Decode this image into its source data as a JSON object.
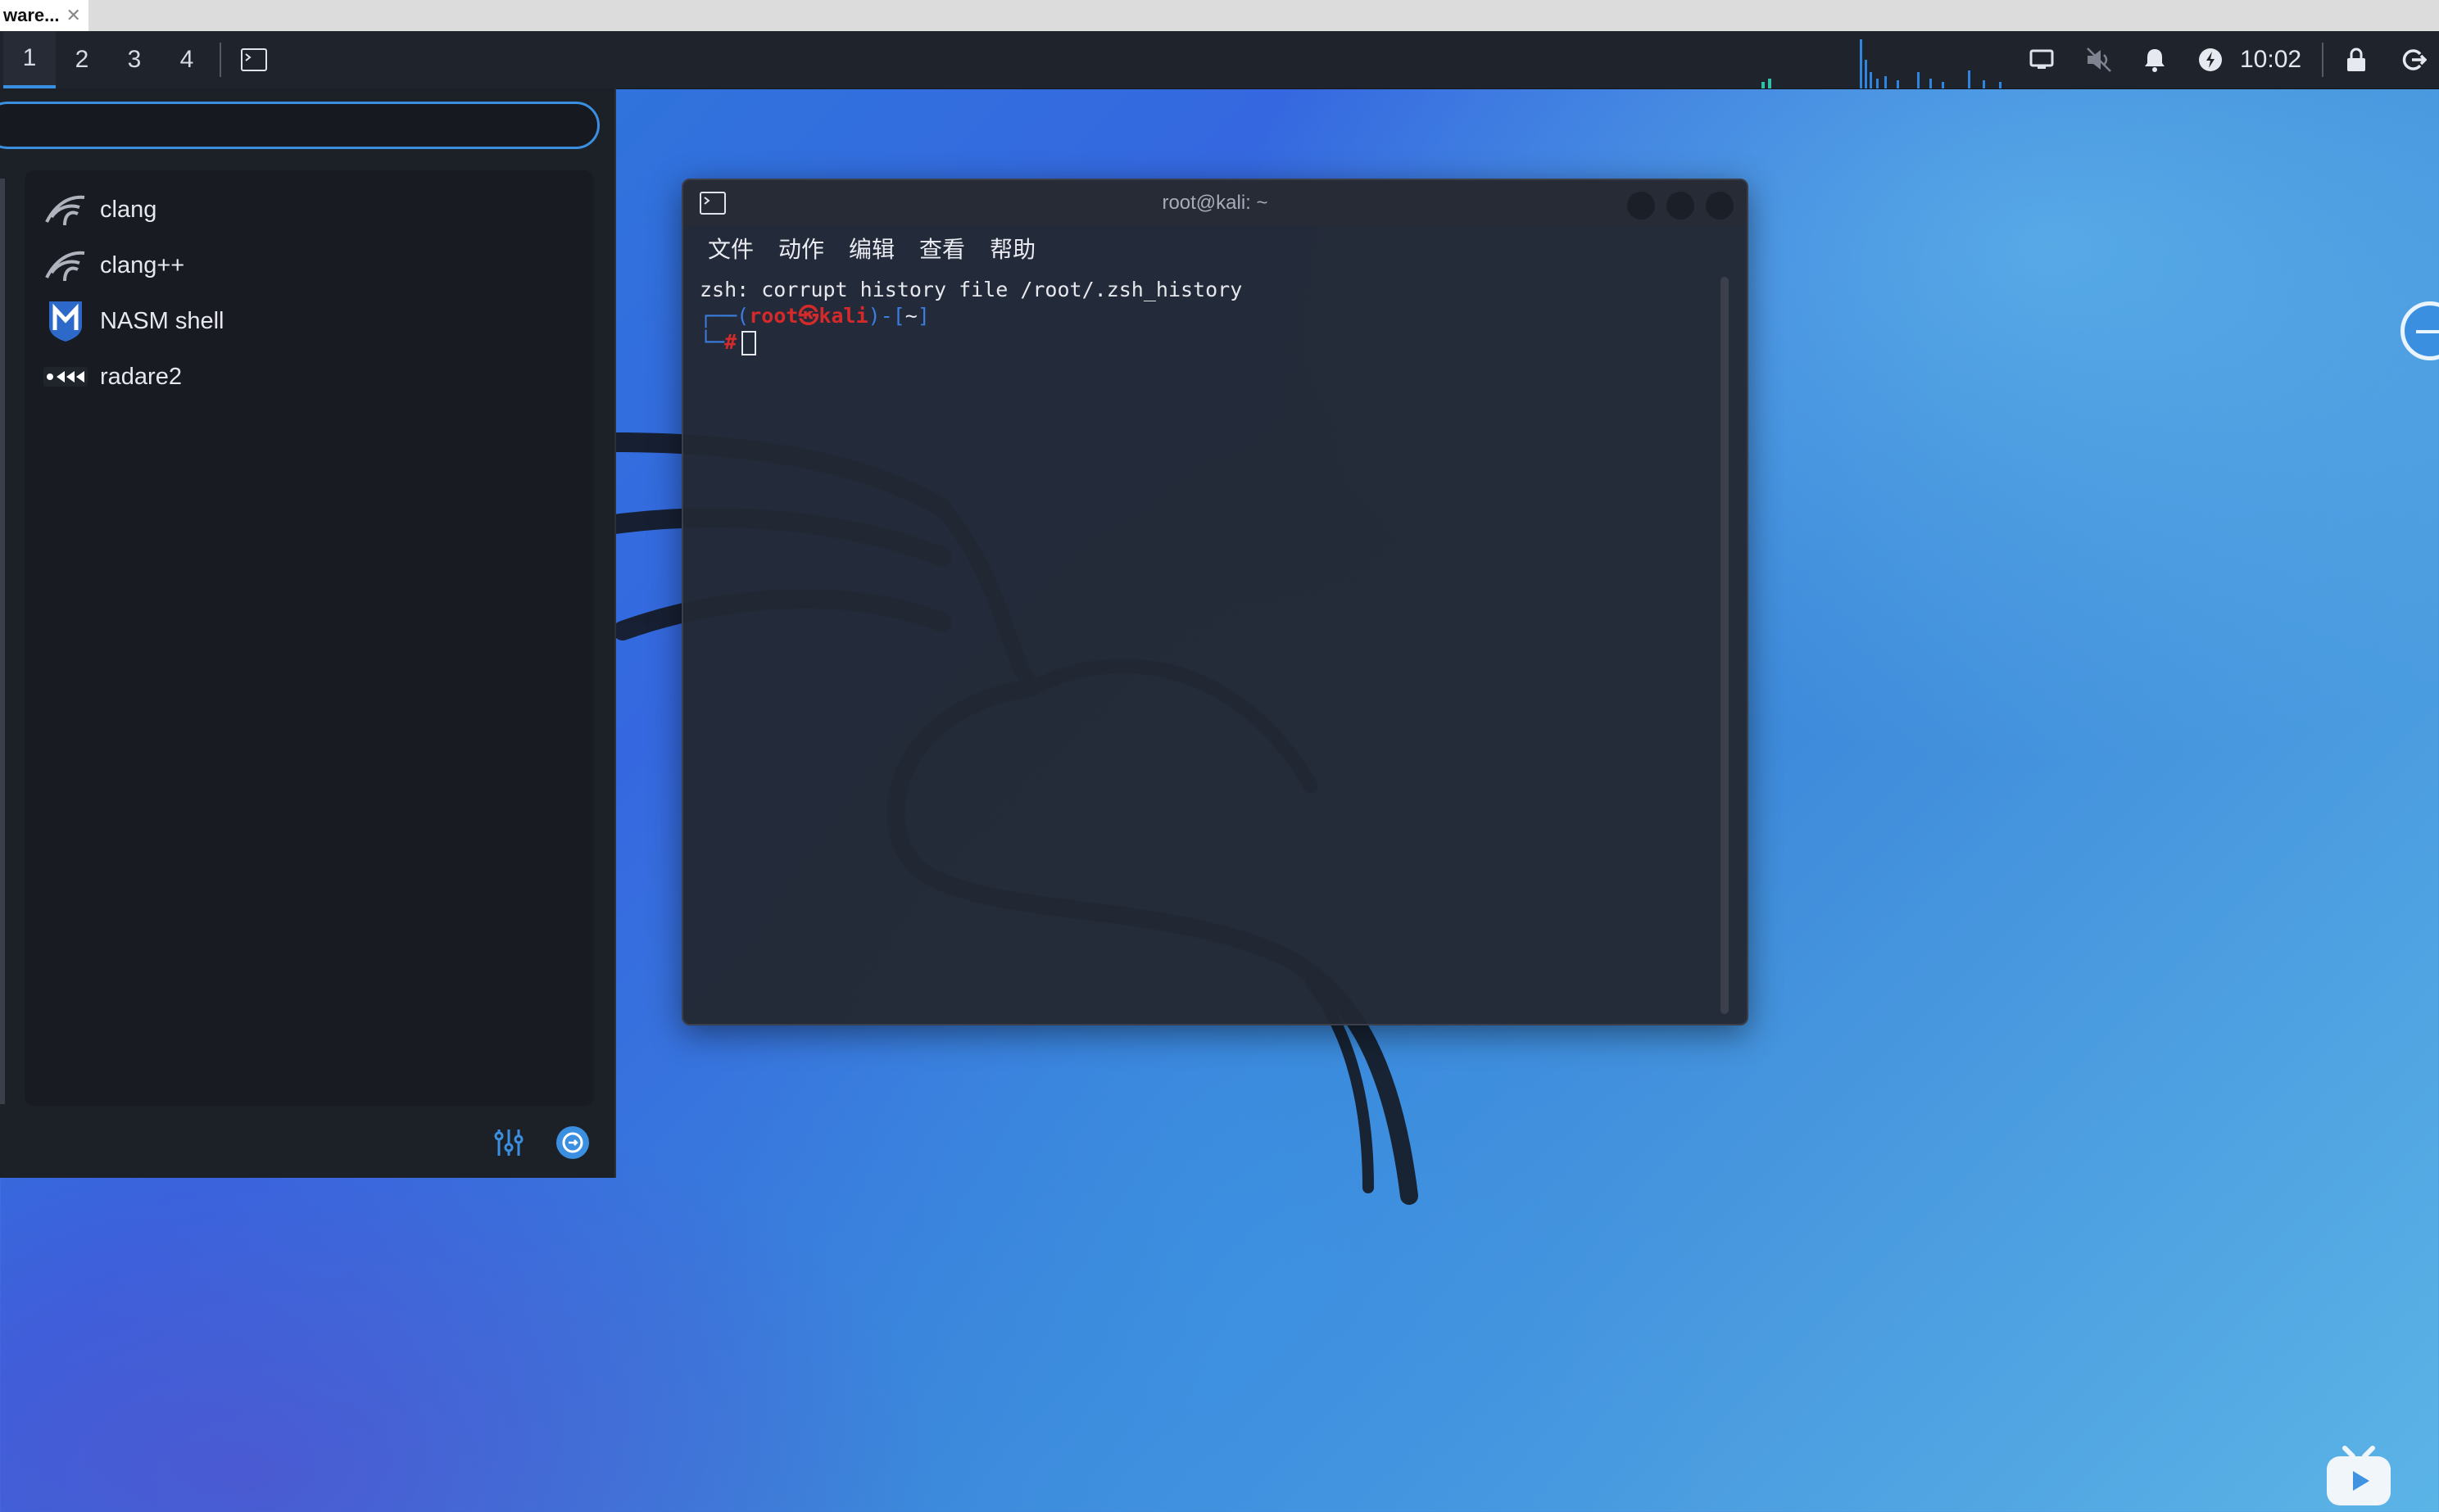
{
  "tab": {
    "title": "ware...",
    "close_icon": "close-icon"
  },
  "panel": {
    "workspaces": [
      "1",
      "2",
      "3",
      "4"
    ],
    "active_workspace": "1",
    "clock": "10:02",
    "icons": [
      "terminal-icon",
      "display-icon",
      "volume-muted-icon",
      "bell-icon",
      "power-manager-icon",
      "lock-icon",
      "logout-icon"
    ]
  },
  "app_menu": {
    "search": {
      "value": "",
      "placeholder": ""
    },
    "items": [
      {
        "label": "clang",
        "icon": "kali-dragon-icon"
      },
      {
        "label": "clang++",
        "icon": "kali-dragon-icon"
      },
      {
        "label": "NASM shell",
        "icon": "metasploit-icon"
      },
      {
        "label": "radare2",
        "icon": "radare2-icon"
      }
    ],
    "footer_icons": [
      "settings-sliders-icon",
      "logout-circle-icon"
    ]
  },
  "terminal": {
    "title": "root@kali: ~",
    "menu": [
      "文件",
      "动作",
      "编辑",
      "查看",
      "帮助"
    ],
    "lines": {
      "line1": "zsh: corrupt history file /root/.zsh_history",
      "prompt_prefix": "┌──(",
      "user_host": "root㉿kali",
      "prompt_mid": ")-[",
      "cwd": "~",
      "prompt_end": "]",
      "prompt2_prefix": "└─",
      "hash": "#"
    }
  },
  "colors": {
    "accent": "#3b8fe0",
    "prompt_red": "#d42a2a",
    "prompt_blue": "#3c7ee0"
  }
}
